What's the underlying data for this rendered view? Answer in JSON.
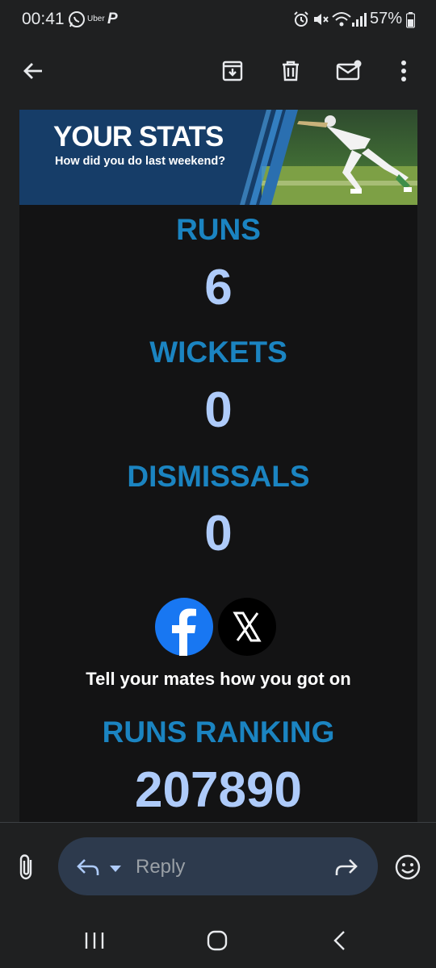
{
  "status_bar": {
    "time": "00:41",
    "uber_label": "Uber",
    "battery": "57%",
    "icons": [
      "whatsapp-icon",
      "uber-icon",
      "paypal-icon",
      "alarm-icon",
      "mute-icon",
      "wifi-icon",
      "signal-icon",
      "battery-icon"
    ]
  },
  "toolbar": {
    "icons": [
      "back-arrow-icon",
      "archive-icon",
      "delete-icon",
      "mark-unread-icon",
      "more-vert-icon"
    ]
  },
  "email": {
    "banner": {
      "title": "YOUR STATS",
      "subtitle": "How did you do last weekend?"
    },
    "stats": [
      {
        "label": "RUNS",
        "value": "6"
      },
      {
        "label": "WICKETS",
        "value": "0"
      },
      {
        "label": "DISMISSALS",
        "value": "0"
      }
    ],
    "social": {
      "icons": [
        "facebook-icon",
        "x-icon"
      ],
      "prompt": "Tell your mates how you got on"
    },
    "ranking": {
      "label": "RUNS RANKING",
      "value": "207890"
    }
  },
  "compose": {
    "reply_placeholder": "Reply",
    "icons": [
      "attachment-icon",
      "reply-icon",
      "dropdown-icon",
      "forward-icon",
      "emoji-icon"
    ]
  },
  "colors": {
    "background": "#1f2021",
    "email_background": "#131314",
    "banner": "#163d68",
    "stat_label": "#1b84c1",
    "stat_value": "#aecbfa",
    "reply_bar": "#2d3a4d",
    "facebook": "#1877f2"
  }
}
